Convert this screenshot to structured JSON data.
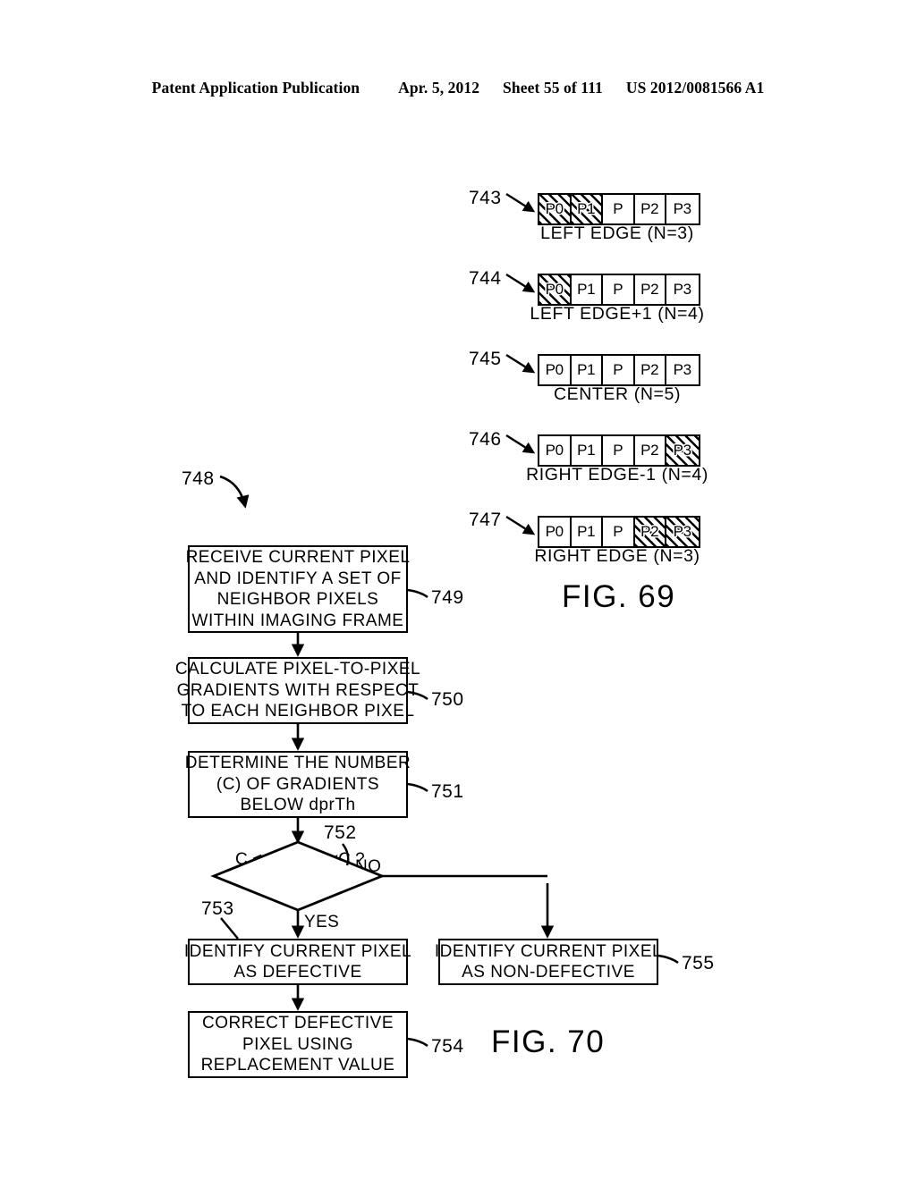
{
  "header": {
    "publication": "Patent Application Publication",
    "date": "Apr. 5, 2012",
    "sheet": "Sheet 55 of 111",
    "patent_number": "US 2012/0081566 A1"
  },
  "fig69": {
    "label": "FIG. 69",
    "rows": [
      {
        "ref": "743",
        "caption": "LEFT EDGE (N=3)",
        "cells": [
          {
            "label": "P0",
            "hatched": true
          },
          {
            "label": "P1",
            "hatched": true
          },
          {
            "label": "P",
            "hatched": false
          },
          {
            "label": "P2",
            "hatched": false
          },
          {
            "label": "P3",
            "hatched": false
          }
        ]
      },
      {
        "ref": "744",
        "caption": "LEFT EDGE+1 (N=4)",
        "cells": [
          {
            "label": "P0",
            "hatched": true
          },
          {
            "label": "P1",
            "hatched": false
          },
          {
            "label": "P",
            "hatched": false
          },
          {
            "label": "P2",
            "hatched": false
          },
          {
            "label": "P3",
            "hatched": false
          }
        ]
      },
      {
        "ref": "745",
        "caption": "CENTER (N=5)",
        "cells": [
          {
            "label": "P0",
            "hatched": false
          },
          {
            "label": "P1",
            "hatched": false
          },
          {
            "label": "P",
            "hatched": false
          },
          {
            "label": "P2",
            "hatched": false
          },
          {
            "label": "P3",
            "hatched": false
          }
        ]
      },
      {
        "ref": "746",
        "caption": "RIGHT EDGE-1 (N=4)",
        "cells": [
          {
            "label": "P0",
            "hatched": false
          },
          {
            "label": "P1",
            "hatched": false
          },
          {
            "label": "P",
            "hatched": false
          },
          {
            "label": "P2",
            "hatched": false
          },
          {
            "label": "P3",
            "hatched": true
          }
        ]
      },
      {
        "ref": "747",
        "caption": "RIGHT EDGE (N=3)",
        "cells": [
          {
            "label": "P0",
            "hatched": false
          },
          {
            "label": "P1",
            "hatched": false
          },
          {
            "label": "P",
            "hatched": false
          },
          {
            "label": "P2",
            "hatched": true
          },
          {
            "label": "P3",
            "hatched": true
          }
        ]
      }
    ]
  },
  "fig70": {
    "label": "FIG. 70",
    "flow_ref": "748",
    "steps": {
      "s749": {
        "ref": "749",
        "lines": [
          "RECEIVE CURRENT PIXEL",
          "AND IDENTIFY A SET OF",
          "NEIGHBOR PIXELS",
          "WITHIN IMAGING FRAME"
        ]
      },
      "s750": {
        "ref": "750",
        "lines": [
          "CALCULATE PIXEL-TO-PIXEL",
          "GRADIENTS WITH RESPECT",
          "TO EACH NEIGHBOR PIXEL"
        ]
      },
      "s751": {
        "ref": "751",
        "lines": [
          "DETERMINE THE NUMBER",
          "(C) OF GRADIENTS",
          "BELOW dprTh"
        ]
      },
      "s752": {
        "ref": "752",
        "lines": [
          "C < =",
          "dprMaxC",
          "?"
        ],
        "yes_label": "YES",
        "no_label": "NO"
      },
      "s753": {
        "ref": "753",
        "lines": [
          "IDENTIFY CURRENT PIXEL",
          "AS DEFECTIVE"
        ]
      },
      "s754": {
        "ref": "754",
        "lines": [
          "CORRECT DEFECTIVE",
          "PIXEL USING",
          "REPLACEMENT VALUE"
        ]
      },
      "s755": {
        "ref": "755",
        "lines": [
          "IDENTIFY CURRENT PIXEL",
          "AS NON-DEFECTIVE"
        ]
      }
    }
  }
}
